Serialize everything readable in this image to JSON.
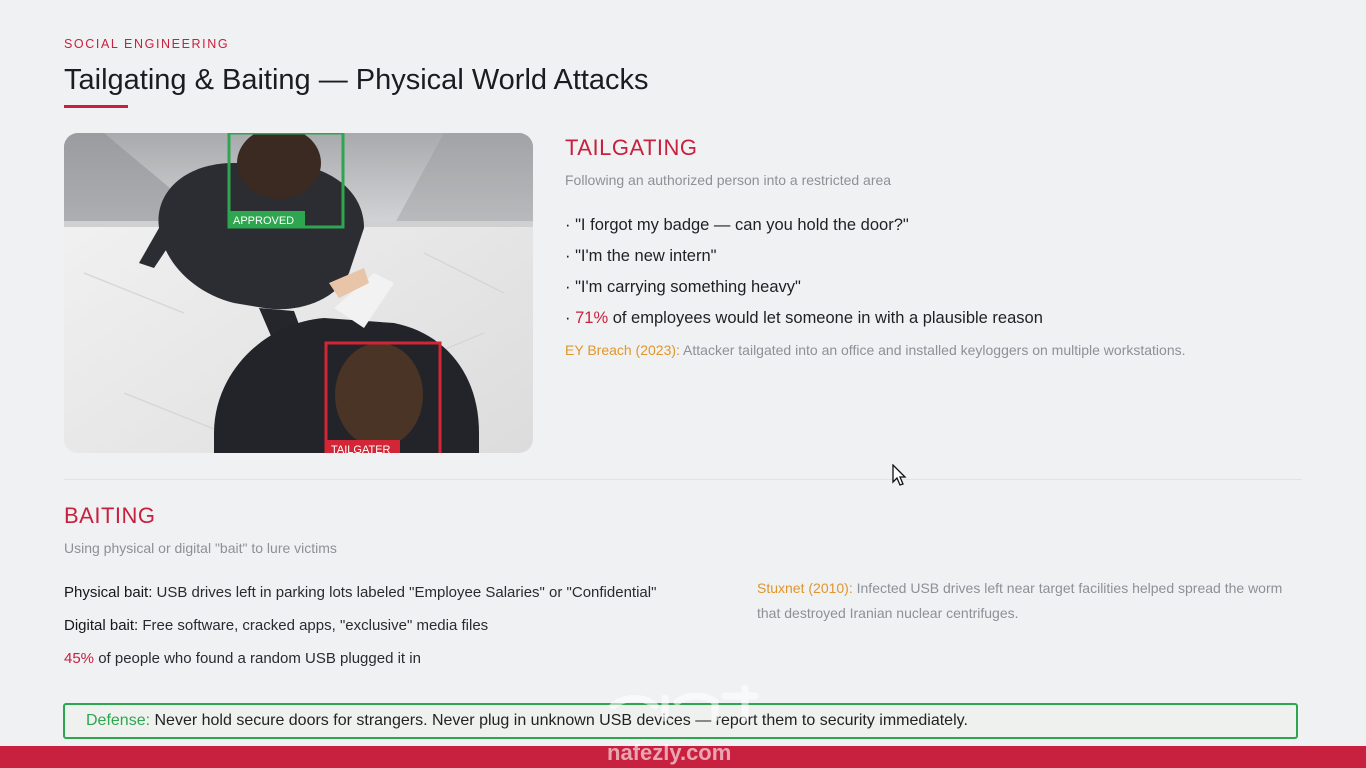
{
  "header": {
    "kicker": "SOCIAL ENGINEERING",
    "title": "Tailgating & Baiting — Physical World Attacks"
  },
  "photo": {
    "approved_tag": "APPROVED",
    "tailgater_tag": "TAILGATER"
  },
  "tailgating": {
    "heading": "TAILGATING",
    "subtitle": "Following an authorized person into a restricted area",
    "bullets": [
      "· \"I forgot my badge — can you hold the door?\"",
      "· \"I'm the new intern\"",
      "· \"I'm carrying something heavy\""
    ],
    "stat_prefix": "· ",
    "stat_value": "71%",
    "stat_text": " of employees would let someone in with a plausible reason",
    "case_label": "EY Breach (2023):",
    "case_text": " Attacker tailgated into an office and installed keyloggers on multiple workstations."
  },
  "baiting": {
    "heading": "BAITING",
    "subtitle": "Using physical or digital \"bait\" to lure victims",
    "physical_label": "Physical bait:",
    "physical_text": " USB drives left in parking lots labeled \"Employee Salaries\" or \"Confidential\"",
    "digital_label": "Digital bait:",
    "digital_text": " Free software, cracked apps, \"exclusive\" media files",
    "stat_value": "45%",
    "stat_text": " of people who found a random USB plugged it in",
    "case_label": "Stuxnet (2010):",
    "case_text": " Infected USB drives left near target facilities helped spread the worm that destroyed Iranian nuclear centrifuges."
  },
  "defense": {
    "label": "Defense:",
    "text": " Never hold secure doors for strangers. Never plug in unknown USB devices — report them to security immediately."
  },
  "watermark": {
    "text": "nafezly.com"
  },
  "colors": {
    "accent_red": "#c8203f",
    "approved_green": "#2ea64f",
    "case_orange": "#e0962b",
    "muted_gray": "#8d9096"
  }
}
